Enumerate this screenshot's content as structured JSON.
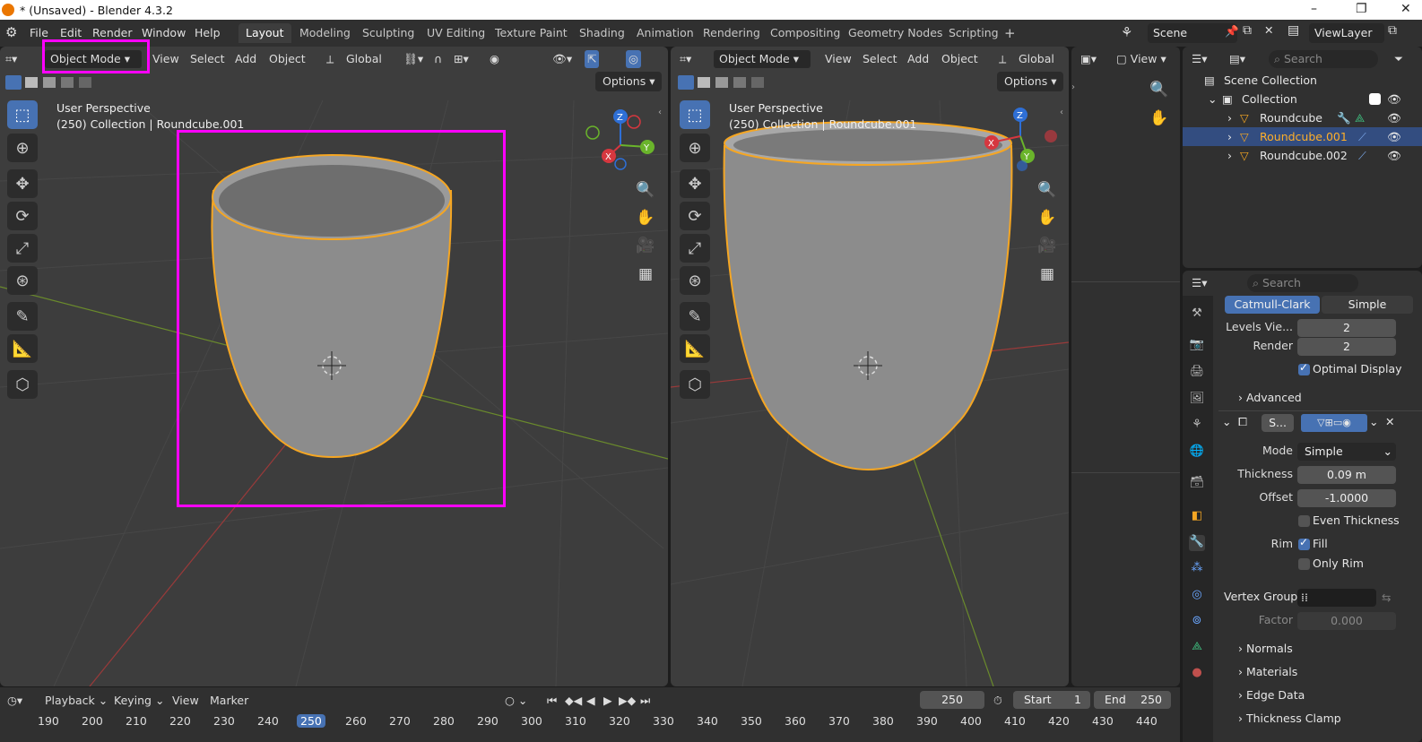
{
  "window_title": "* (Unsaved) - Blender 4.3.2",
  "menus": [
    "File",
    "Edit",
    "Render",
    "Window",
    "Help"
  ],
  "workspaces": [
    "Layout",
    "Modeling",
    "Sculpting",
    "UV Editing",
    "Texture Paint",
    "Shading",
    "Animation",
    "Rendering",
    "Compositing",
    "Geometry Nodes",
    "Scripting",
    "+"
  ],
  "scene": "Scene",
  "view_layer": "ViewLayer",
  "left_view": {
    "mode": "Object Mode",
    "menus": [
      "View",
      "Select",
      "Add",
      "Object"
    ],
    "orientation": "Global",
    "options": "Options",
    "overlay_line1": "User Perspective",
    "overlay_line2": "(250) Collection | Roundcube.001"
  },
  "right_view": {
    "mode": "Object Mode",
    "menus": [
      "View",
      "Select",
      "Add",
      "Object"
    ],
    "orientation": "Global",
    "options": "Options",
    "overlay_line1": "User Perspective",
    "overlay_line2": "(250) Collection | Roundcube.001"
  },
  "image_editor": {
    "view_label": "View"
  },
  "outliner": {
    "search_placeholder": "Search",
    "root": "Scene Collection",
    "collection": "Collection",
    "objects": [
      "Roundcube",
      "Roundcube.001",
      "Roundcube.002"
    ],
    "selected_index": 1
  },
  "properties": {
    "search_placeholder": "Search",
    "subdiv_types": [
      "Catmull-Clark",
      "Simple"
    ],
    "levels_viewport_label": "Levels Vie...",
    "levels_viewport": "2",
    "render_label": "Render",
    "render_value": "2",
    "optimal_display": "Optimal Display",
    "advanced": "Advanced",
    "modifier_name": "S...",
    "mode_label": "Mode",
    "mode_value": "Simple",
    "thickness_label": "Thickness",
    "thickness_value": "0.09 m",
    "offset_label": "Offset",
    "offset_value": "-1.0000",
    "even_thickness": "Even Thickness",
    "rim_label": "Rim",
    "fill": "Fill",
    "only_rim": "Only Rim",
    "vertex_group_label": "Vertex Group",
    "factor_label": "Factor",
    "factor_value": "0.000",
    "sections": [
      "Normals",
      "Materials",
      "Edge Data",
      "Thickness Clamp"
    ]
  },
  "timeline": {
    "menus": [
      "Playback",
      "Keying",
      "View",
      "Marker"
    ],
    "current_frame": "250",
    "start_label": "Start",
    "start_value": "1",
    "end_label": "End",
    "end_value": "250",
    "frame_ticks": [
      "190",
      "200",
      "210",
      "220",
      "230",
      "240",
      "250",
      "260",
      "270",
      "280",
      "290",
      "300",
      "310",
      "320",
      "330",
      "340",
      "350",
      "360",
      "370",
      "380",
      "390",
      "400",
      "410",
      "420",
      "430",
      "440"
    ]
  },
  "colors": {
    "highlight": "#ff00ff",
    "accent": "#4772b3",
    "selected_text": "#ffaf29",
    "outline": "#f5a623"
  }
}
